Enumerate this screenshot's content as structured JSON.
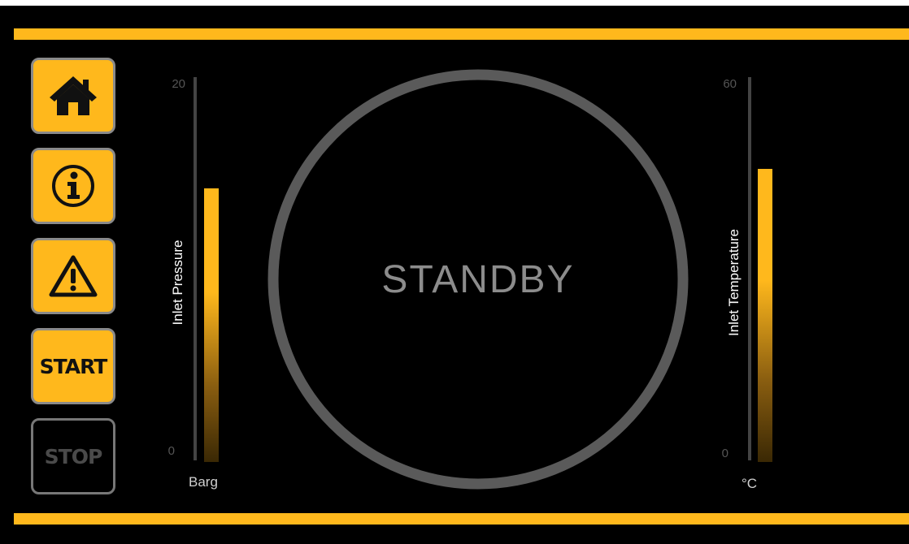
{
  "nav": {
    "home_icon": "home-icon",
    "info_icon": "info-icon",
    "alarm_icon": "warning-icon",
    "start_label": "START",
    "stop_label": "STOP",
    "stop_enabled": false
  },
  "gauges": {
    "pressure": {
      "title": "Inlet Pressure",
      "unit": "Barg",
      "min_label": "20",
      "zero_label": "0",
      "min": 0,
      "max": 20,
      "value": 14.2
    },
    "temperature": {
      "title": "Inlet Temperature",
      "unit": "°C",
      "min_label": "60",
      "zero_label": "0",
      "min": 0,
      "max": 60,
      "value": 45.7
    }
  },
  "status": {
    "text": "STANDBY"
  },
  "colors": {
    "accent": "#ffb81c",
    "background": "#000000",
    "ring": "#5a5a5a",
    "status_text": "#8c8c8c"
  }
}
